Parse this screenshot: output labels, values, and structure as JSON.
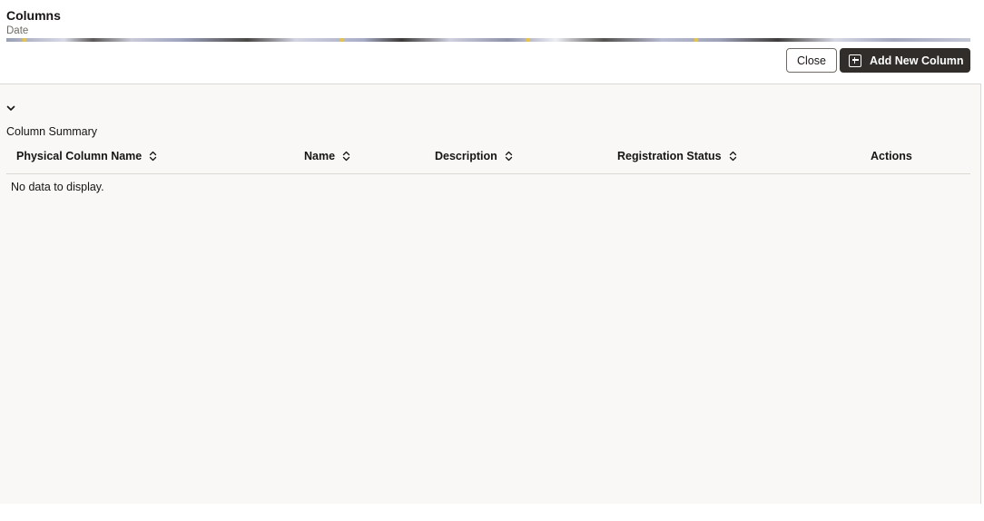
{
  "header": {
    "title": "Columns",
    "subtitle": "Date"
  },
  "toolbar": {
    "close_label": "Close",
    "add_label": "Add New Column"
  },
  "section": {
    "title": "Column Summary"
  },
  "table": {
    "columns": [
      {
        "label": "Physical Column Name",
        "sortable": true
      },
      {
        "label": "Name",
        "sortable": true
      },
      {
        "label": "Description",
        "sortable": true
      },
      {
        "label": "Registration Status",
        "sortable": true
      },
      {
        "label": "Actions",
        "sortable": false
      }
    ],
    "empty_message": "No data to display."
  },
  "icons": {
    "add": "plus-square-icon",
    "collapse": "chevron-down-icon",
    "sort": "sort-arrows-icon"
  },
  "colors": {
    "primary_button": "#312d2a",
    "background": "#f9f8f6"
  }
}
